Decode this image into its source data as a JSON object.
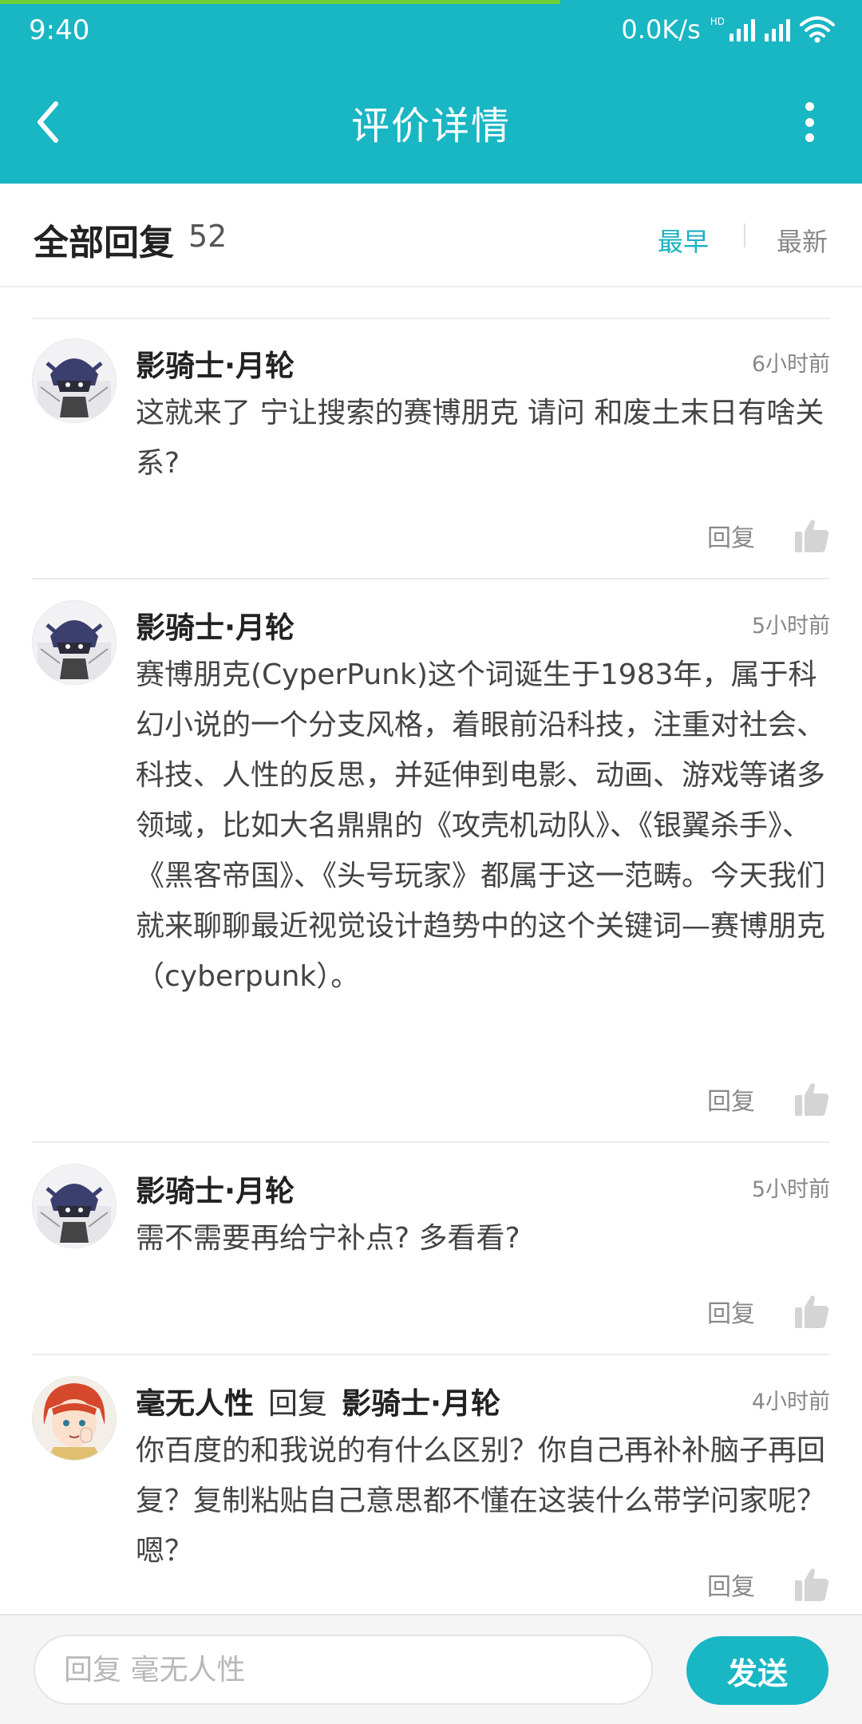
{
  "status_bar": {
    "time": "9:40",
    "net_speed": "0.0K/s",
    "hd_label": "HD",
    "progress_fraction": 0.65
  },
  "app_bar": {
    "title": "评价详情",
    "back_icon": "chevron-left-icon",
    "more_icon": "more-vertical-icon"
  },
  "section": {
    "title": "全部回复",
    "count": "52",
    "sort_earliest": "最早",
    "sort_latest": "最新",
    "active_sort_color": "#19b0bf"
  },
  "comments": [
    {
      "author": "影骑士·月轮",
      "time": "6小时前",
      "text": "这就来了  宁让搜索的赛博朋克   请问  和废土末日有啥关系?",
      "reply_label": "回复"
    },
    {
      "author": "影骑士·月轮",
      "time": "5小时前",
      "text": "赛博朋克(CyperPunk)这个词诞生于1983年，属于科幻小说的一个分支风格，着眼前沿科技，注重对社会、科技、人性的反思，并延伸到电影、动画、游戏等诸多领域，比如大名鼎鼎的《攻壳机动队》、《银翼杀手》、《黑客帝国》、《头号玩家》都属于这一范畴。今天我们就来聊聊最近视觉设计趋势中的这个关键词—赛博朋克（cyberpunk）。",
      "reply_label": "回复"
    },
    {
      "author": "影骑士·月轮",
      "time": "5小时前",
      "text": "需不需要再给宁补点?   多看看?",
      "reply_label": "回复"
    },
    {
      "author": "毫无人性",
      "reply_word": "回复",
      "reply_to": "影骑士·月轮",
      "time": "4小时前",
      "text": "你百度的和我说的有什么区别？你自己再补补脑子再回复？复制粘贴自己意思都不懂在这装什么带学问家呢？嗯？",
      "reply_label": "回复"
    }
  ],
  "reply_bar": {
    "placeholder": "回复 毫无人性",
    "send_label": "发送"
  },
  "colors": {
    "brand": "#19b6c4",
    "progress": "#6fd13a"
  }
}
